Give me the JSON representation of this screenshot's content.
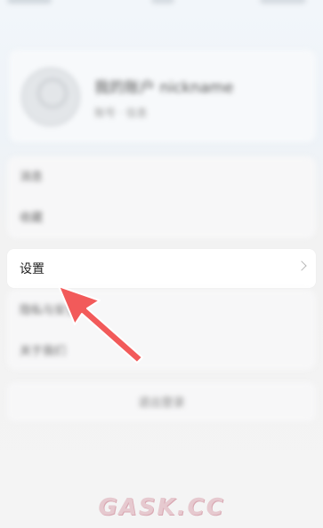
{
  "status_bar": {},
  "profile": {
    "name": "我的账户 nickname",
    "sub": "账号 · 信息"
  },
  "list_top": {
    "items": [
      "消息",
      "收藏"
    ]
  },
  "settings_row": {
    "label": "设置",
    "chevron_icon": "chevron-right-icon"
  },
  "list_bottom": {
    "items": [
      "隐私与安全",
      "关于我们"
    ]
  },
  "bottom_button": {
    "label": "退出登录"
  },
  "annotation": {
    "arrow_color": "#f25a5a",
    "arrow_icon": "pointer-arrow-icon"
  },
  "watermark": {
    "text": "GASK.CC"
  },
  "colors": {
    "accent_arrow": "#f25a5a",
    "background": "#f3f4f6"
  }
}
